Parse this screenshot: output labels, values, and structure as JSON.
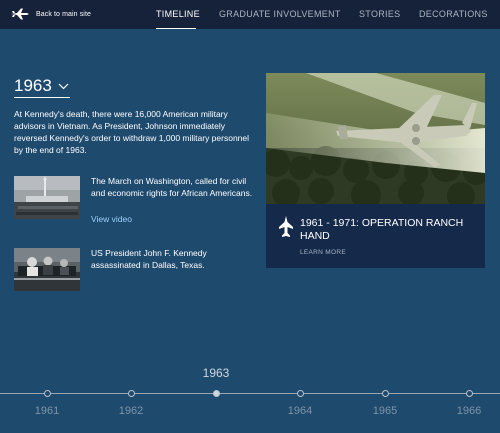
{
  "header": {
    "back_label": "Back to main site",
    "nav": [
      "TIMELINE",
      "GRADUATE INVOLVEMENT",
      "STORIES",
      "DECORATIONS"
    ],
    "active_nav": "TIMELINE"
  },
  "year_selector": {
    "value": "1963"
  },
  "intro": "At Kennedy's death, there were 16,000 American military advisors in Vietnam. As President, Johnson immediately reversed Kennedy's order to withdraw 1,000 military personnel by the end of 1963.",
  "events": [
    {
      "text": "The March on Washington, called for civil and economic rights for African Americans.",
      "link": "View video"
    },
    {
      "text": "US President John F. Kennedy assassinated in Dallas, Texas."
    }
  ],
  "feature": {
    "title": "1961 - 1971: OPERATION RANCH HAND",
    "more": "LEARN MORE"
  },
  "timeline": {
    "current": "1963",
    "years": [
      "1961",
      "1962",
      "1964",
      "1965",
      "1966"
    ]
  },
  "colors": {
    "background": "#1e4a6e",
    "header": "#16223a",
    "card": "#15294a",
    "link": "#9ecff5"
  }
}
